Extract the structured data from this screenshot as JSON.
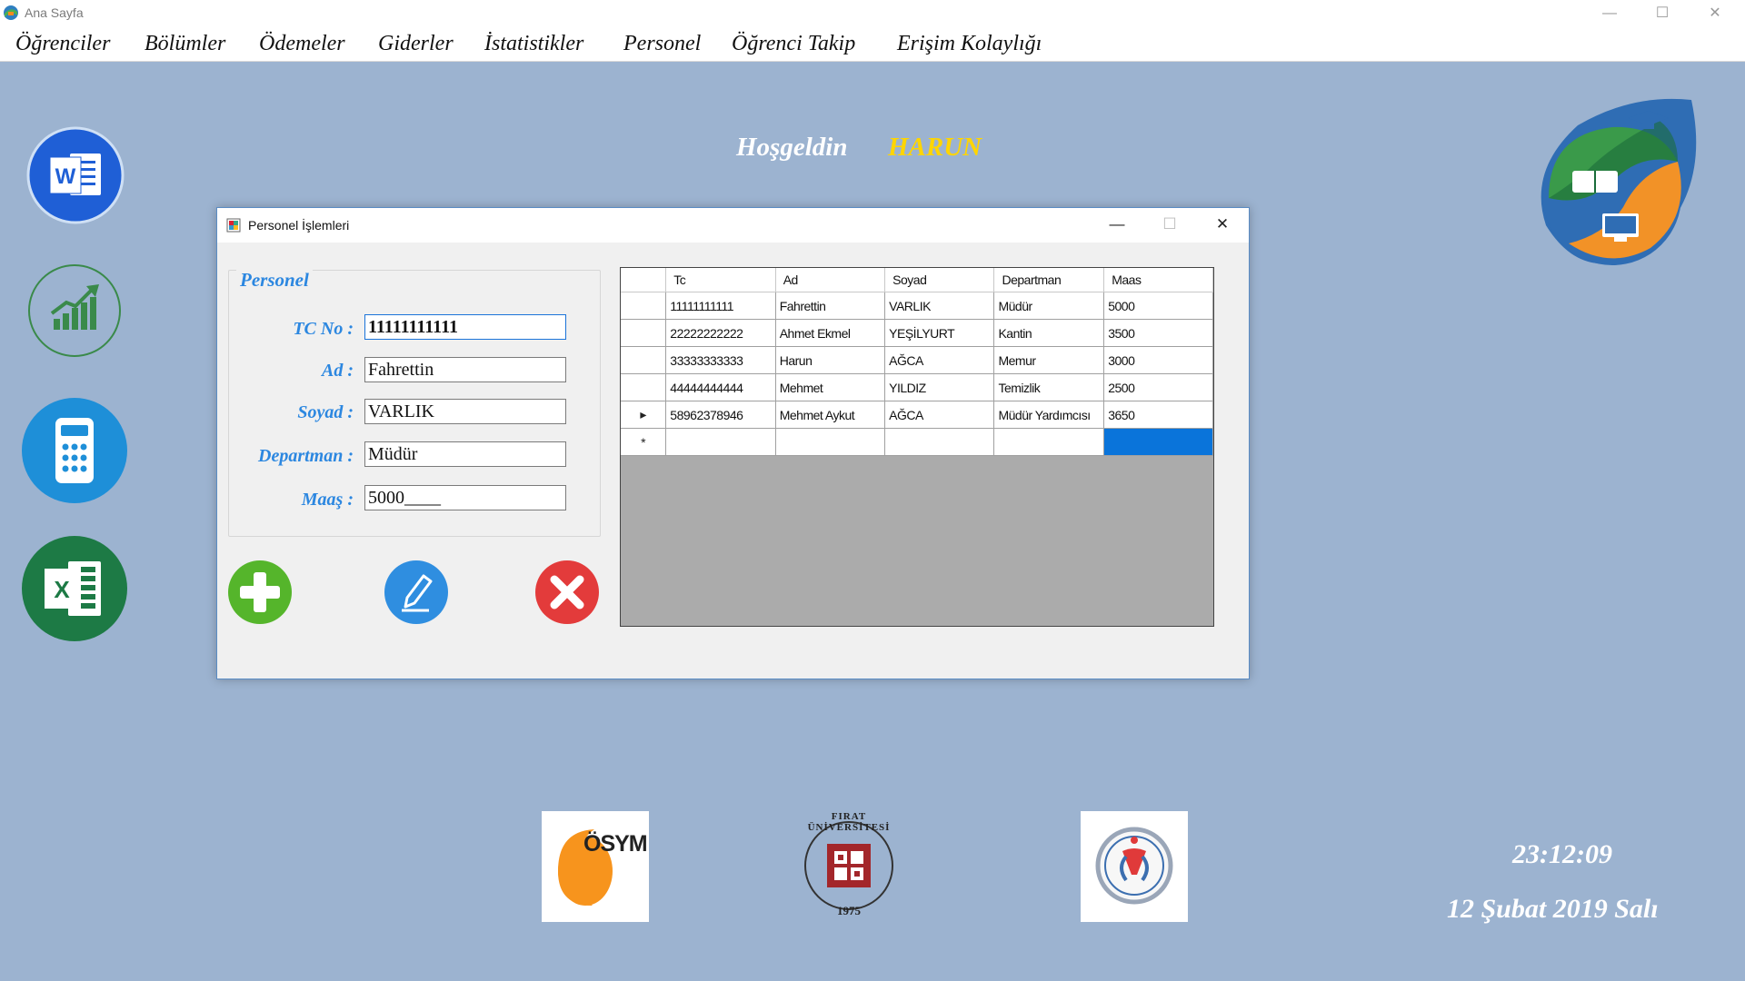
{
  "window": {
    "title": "Ana Sayfa"
  },
  "menu": [
    "Öğrenciler",
    "Bölümler",
    "Ödemeler",
    "Giderler",
    "İstatistikler",
    "Personel",
    "Öğrenci Takip",
    "Erişim Kolaylığı"
  ],
  "welcome": {
    "greeting": "Hoşgeldin",
    "user": "HARUN"
  },
  "sidebar": [
    "word-icon",
    "chart-icon",
    "calculator-icon",
    "excel-icon"
  ],
  "logos": {
    "osym": "ÖSYM",
    "firat_top": "FIRAT ÜNİVERSİTESİ",
    "firat_year": "1975"
  },
  "clock": {
    "time": "23:12:09",
    "date": "12 Şubat 2019 Salı"
  },
  "dialog": {
    "title": "Personel İşlemleri",
    "group_title": "Personel",
    "fields": {
      "tc": {
        "label": "TC No :",
        "value": "11111111111"
      },
      "ad": {
        "label": "Ad :",
        "value": "Fahrettin"
      },
      "soyad": {
        "label": "Soyad :",
        "value": "VARLIK"
      },
      "departman": {
        "label": "Departman :",
        "value": "Müdür"
      },
      "maas": {
        "label": "Maaş :",
        "value": "5000____"
      }
    },
    "table": {
      "columns": [
        "Tc",
        "Ad",
        "Soyad",
        "Departman",
        "Maas"
      ],
      "rows": [
        [
          "11111111111",
          "Fahrettin",
          "VARLIK",
          "Müdür",
          "5000"
        ],
        [
          "22222222222",
          "Ahmet Ekmel",
          "YEŞİLYURT",
          "Kantin",
          "3500"
        ],
        [
          "33333333333",
          "Harun",
          "AĞCA",
          "Memur",
          "3000"
        ],
        [
          "44444444444",
          "Mehmet",
          "YILDIZ",
          "Temizlik",
          "2500"
        ],
        [
          "58962378946",
          "Mehmet Aykut",
          "AĞCA",
          "Müdür Yardımcısı",
          "3650"
        ]
      ],
      "current_row_marker": "▸",
      "new_row_marker": "*"
    }
  },
  "colors": {
    "background": "#9cb3d0",
    "accent": "#2c87e0",
    "welcome_user": "#ffd500"
  }
}
